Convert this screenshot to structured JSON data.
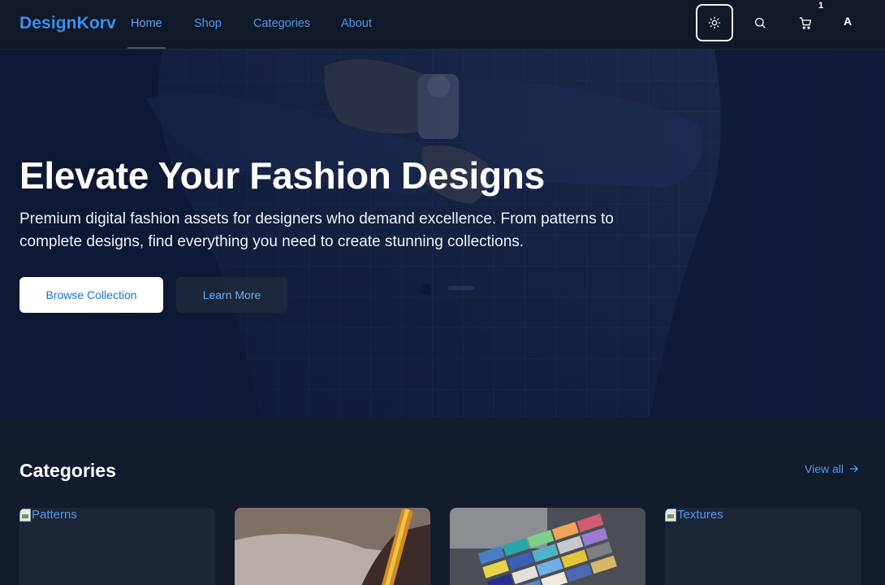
{
  "nav": {
    "brand": "DesignKorv",
    "links": [
      "Home",
      "Shop",
      "Categories",
      "About"
    ],
    "cart_count": "1",
    "avatar_initial": "A",
    "icons": {
      "theme": "sun-icon",
      "search": "search-icon",
      "cart": "shopping-cart-icon"
    }
  },
  "hero": {
    "title": "Elevate Your Fashion Designs",
    "subtitle": "Premium digital fashion assets for designers who demand excellence. From patterns to complete designs, find everything you need to create stunning collections.",
    "primary_button": "Browse Collection",
    "secondary_button": "Learn More"
  },
  "categories": {
    "title": "Categories",
    "view_all": "View all",
    "cards": [
      {
        "alt": "Patterns",
        "image_loaded": false
      },
      {
        "alt": "",
        "image_loaded": true,
        "image": "hand-sketching-with-pencil"
      },
      {
        "alt": "",
        "image_loaded": true,
        "image": "fabric-color-swatches"
      },
      {
        "alt": "Textures",
        "image_loaded": false
      }
    ]
  },
  "colors": {
    "background": "#111827",
    "accent": "#3b8ff0",
    "section_background": "#131c2c"
  }
}
